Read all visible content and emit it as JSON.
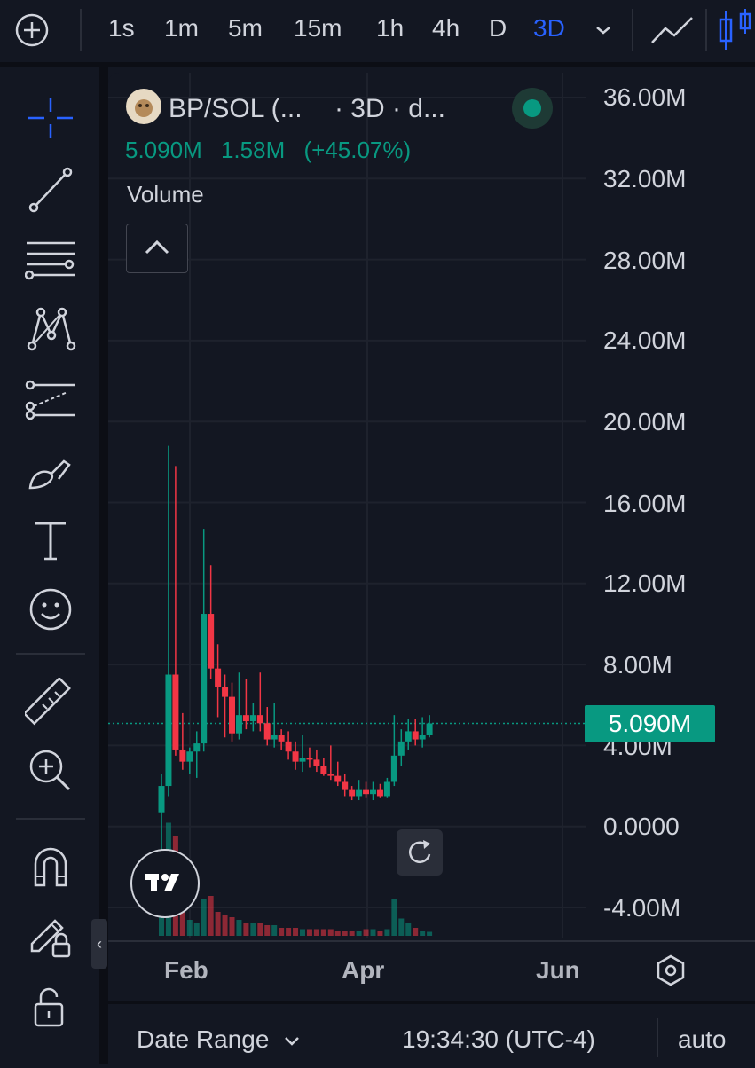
{
  "topbar": {
    "timeframes": [
      "1s",
      "1m",
      "5m",
      "15m",
      "1h",
      "4h",
      "D",
      "3D"
    ],
    "active_timeframe": "3D",
    "icons": [
      "add-circle-icon",
      "chevron-down-icon",
      "line-chart-icon",
      "candles-icon"
    ]
  },
  "left_toolbar": {
    "tools": [
      "crosshair-icon",
      "trend-line-icon",
      "fib-lines-icon",
      "pattern-icon",
      "forecast-icon",
      "brush-icon",
      "text-icon",
      "emoji-icon",
      "ruler-icon",
      "zoom-in-icon",
      "magnet-icon",
      "lock-drawing-icon",
      "unlock-icon"
    ]
  },
  "legend": {
    "symbol": "BP/SOL (...",
    "interval": "· 3D · d...",
    "last_price": "5.090M",
    "change": "1.58M",
    "change_pct": "(+45.07%)",
    "status_color": "#089981"
  },
  "volume_label": "Volume",
  "price_axis": {
    "ticks": [
      "36.00M",
      "32.00M",
      "28.00M",
      "24.00M",
      "20.00M",
      "16.00M",
      "12.00M",
      "8.00M",
      "4.00M",
      "0.0000",
      "-4.00M"
    ],
    "current_price_label": "5.090M"
  },
  "time_axis": {
    "labels": [
      "Feb",
      "Apr",
      "Jun"
    ]
  },
  "bottombar": {
    "date_range": "Date Range",
    "time": "19:34:30 (UTC-4)",
    "scale": "auto"
  },
  "colors": {
    "up": "#089981",
    "down": "#f23645",
    "accent": "#2962ff",
    "background": "#131722"
  },
  "chart_data": {
    "type": "candlestick",
    "ylim": [
      -4000000,
      36000000
    ],
    "last_price": 5090000,
    "candles": [
      {
        "o": 700000,
        "h": 2600000,
        "l": -1500000,
        "c": 2000000
      },
      {
        "o": 2000000,
        "h": 18800000,
        "l": 1500000,
        "c": 7500000
      },
      {
        "o": 7500000,
        "h": 17800000,
        "l": 3500000,
        "c": 3800000
      },
      {
        "o": 3800000,
        "h": 5600000,
        "l": 2800000,
        "c": 3200000
      },
      {
        "o": 3200000,
        "h": 3900000,
        "l": 2600000,
        "c": 3700000
      },
      {
        "o": 3700000,
        "h": 4700000,
        "l": 2400000,
        "c": 4100000
      },
      {
        "o": 4100000,
        "h": 14700000,
        "l": 3700000,
        "c": 10500000
      },
      {
        "o": 10500000,
        "h": 12900000,
        "l": 7300000,
        "c": 7800000
      },
      {
        "o": 7800000,
        "h": 9000000,
        "l": 5400000,
        "c": 6900000
      },
      {
        "o": 6900000,
        "h": 7500000,
        "l": 4400000,
        "c": 6400000
      },
      {
        "o": 6400000,
        "h": 7100000,
        "l": 4200000,
        "c": 4600000
      },
      {
        "o": 4600000,
        "h": 7600000,
        "l": 4300000,
        "c": 5500000
      },
      {
        "o": 5500000,
        "h": 7300000,
        "l": 4800000,
        "c": 5200000
      },
      {
        "o": 5200000,
        "h": 6100000,
        "l": 4700000,
        "c": 5500000
      },
      {
        "o": 5500000,
        "h": 7600000,
        "l": 4700000,
        "c": 5100000
      },
      {
        "o": 5100000,
        "h": 5900000,
        "l": 4000000,
        "c": 4300000
      },
      {
        "o": 4300000,
        "h": 6100000,
        "l": 3900000,
        "c": 4500000
      },
      {
        "o": 4500000,
        "h": 4800000,
        "l": 3800000,
        "c": 4200000
      },
      {
        "o": 4200000,
        "h": 4700000,
        "l": 3300000,
        "c": 3700000
      },
      {
        "o": 3700000,
        "h": 4200000,
        "l": 2800000,
        "c": 3200000
      },
      {
        "o": 3200000,
        "h": 4500000,
        "l": 2700000,
        "c": 3400000
      },
      {
        "o": 3400000,
        "h": 3900000,
        "l": 2900000,
        "c": 3300000
      },
      {
        "o": 3300000,
        "h": 3800000,
        "l": 2700000,
        "c": 3000000
      },
      {
        "o": 3000000,
        "h": 3400000,
        "l": 2500000,
        "c": 2600000
      },
      {
        "o": 2600000,
        "h": 4000000,
        "l": 2300000,
        "c": 2500000
      },
      {
        "o": 2500000,
        "h": 3200000,
        "l": 2000000,
        "c": 2200000
      },
      {
        "o": 2200000,
        "h": 2600000,
        "l": 1500000,
        "c": 1800000
      },
      {
        "o": 1800000,
        "h": 2000000,
        "l": 1300000,
        "c": 1500000
      },
      {
        "o": 1500000,
        "h": 2300000,
        "l": 1300000,
        "c": 1800000
      },
      {
        "o": 1800000,
        "h": 2200000,
        "l": 1400000,
        "c": 1600000
      },
      {
        "o": 1600000,
        "h": 2200000,
        "l": 1300000,
        "c": 1800000
      },
      {
        "o": 1800000,
        "h": 2100000,
        "l": 1400000,
        "c": 1500000
      },
      {
        "o": 1500000,
        "h": 2400000,
        "l": 1400000,
        "c": 2200000
      },
      {
        "o": 2200000,
        "h": 5500000,
        "l": 2000000,
        "c": 3500000
      },
      {
        "o": 3500000,
        "h": 4800000,
        "l": 3000000,
        "c": 4200000
      },
      {
        "o": 4200000,
        "h": 5300000,
        "l": 3800000,
        "c": 4700000
      },
      {
        "o": 4700000,
        "h": 5300000,
        "l": 4000000,
        "c": 4300000
      },
      {
        "o": 4300000,
        "h": 5400000,
        "l": 3900000,
        "c": 4500000
      },
      {
        "o": 4500000,
        "h": 5500000,
        "l": 4400000,
        "c": 5090000
      }
    ],
    "volume": [
      0.22,
      0.85,
      0.75,
      0.2,
      0.12,
      0.1,
      0.28,
      0.3,
      0.18,
      0.16,
      0.14,
      0.12,
      0.1,
      0.1,
      0.1,
      0.08,
      0.08,
      0.06,
      0.06,
      0.06,
      0.05,
      0.05,
      0.05,
      0.05,
      0.05,
      0.04,
      0.04,
      0.04,
      0.04,
      0.05,
      0.05,
      0.04,
      0.05,
      0.28,
      0.13,
      0.1,
      0.06,
      0.04,
      0.03
    ]
  }
}
